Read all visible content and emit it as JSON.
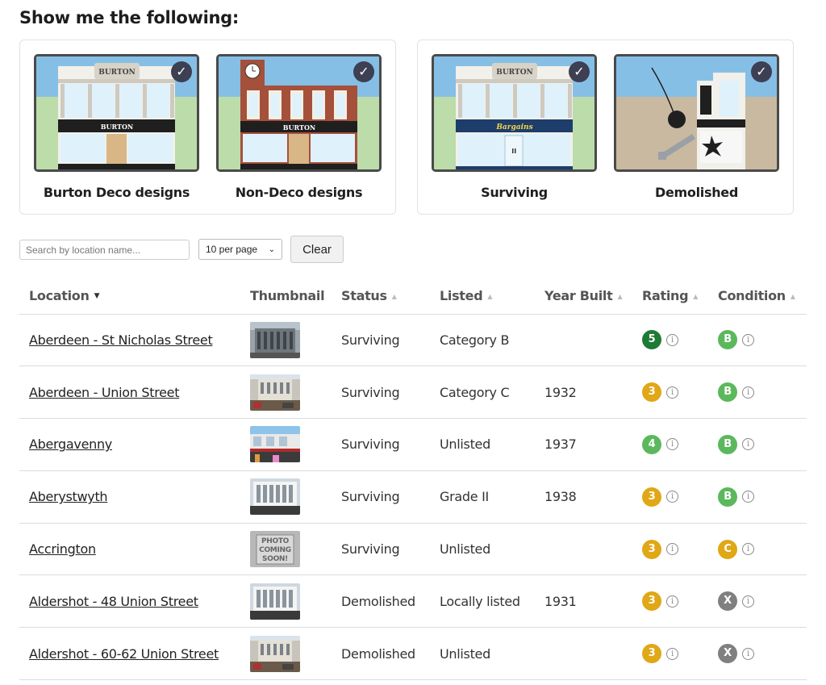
{
  "heading": "Show me the following:",
  "filters": {
    "design": [
      {
        "label": "Burton Deco designs",
        "checked": true
      },
      {
        "label": "Non-Deco designs",
        "checked": true
      }
    ],
    "state": [
      {
        "label": "Surviving",
        "checked": true
      },
      {
        "label": "Demolished",
        "checked": true
      }
    ],
    "sign_text": "BURTON",
    "bargain_text": "Bargains"
  },
  "controls": {
    "search_placeholder": "Search by location name...",
    "per_page": "10 per page",
    "clear_label": "Clear"
  },
  "table": {
    "headers": {
      "location": "Location",
      "thumbnail": "Thumbnail",
      "status": "Status",
      "listed": "Listed",
      "year": "Year Built",
      "rating": "Rating",
      "condition": "Condition"
    },
    "rows": [
      {
        "location": "Aberdeen - St Nicholas Street",
        "status": "Surviving",
        "listed": "Category B",
        "year": "",
        "rating": "5",
        "condition": "B",
        "thumb": "granite"
      },
      {
        "location": "Aberdeen - Union Street",
        "status": "Surviving",
        "listed": "Category C",
        "year": "1932",
        "rating": "3",
        "condition": "B",
        "thumb": "street"
      },
      {
        "location": "Abergavenny",
        "status": "Surviving",
        "listed": "Unlisted",
        "year": "1937",
        "rating": "4",
        "condition": "B",
        "thumb": "shopfront"
      },
      {
        "location": "Aberystwyth",
        "status": "Surviving",
        "listed": "Grade II",
        "year": "1938",
        "rating": "3",
        "condition": "B",
        "thumb": "white"
      },
      {
        "location": "Accrington",
        "status": "Surviving",
        "listed": "Unlisted",
        "year": "",
        "rating": "3",
        "condition": "C",
        "thumb": "placeholder"
      },
      {
        "location": "Aldershot - 48 Union Street",
        "status": "Demolished",
        "listed": "Locally listed",
        "year": "1931",
        "rating": "3",
        "condition": "X",
        "thumb": "white"
      },
      {
        "location": "Aldershot - 60-62 Union Street",
        "status": "Demolished",
        "listed": "Unlisted",
        "year": "",
        "rating": "3",
        "condition": "X",
        "thumb": "street"
      }
    ],
    "placeholder_thumb_text": [
      "PHOTO",
      "COMING",
      "SOON!"
    ]
  },
  "colors": {
    "rating_5": "#1e7a34",
    "rating_4": "#5cb85c",
    "rating_3": "#e0a716",
    "condition_B": "#5cb85c",
    "condition_C": "#e0a716",
    "condition_X": "#808080",
    "check_bg": "#3d3f52"
  },
  "icons": {
    "check": "check-icon",
    "info": "info-icon",
    "sort": "sort-arrow-icon"
  }
}
